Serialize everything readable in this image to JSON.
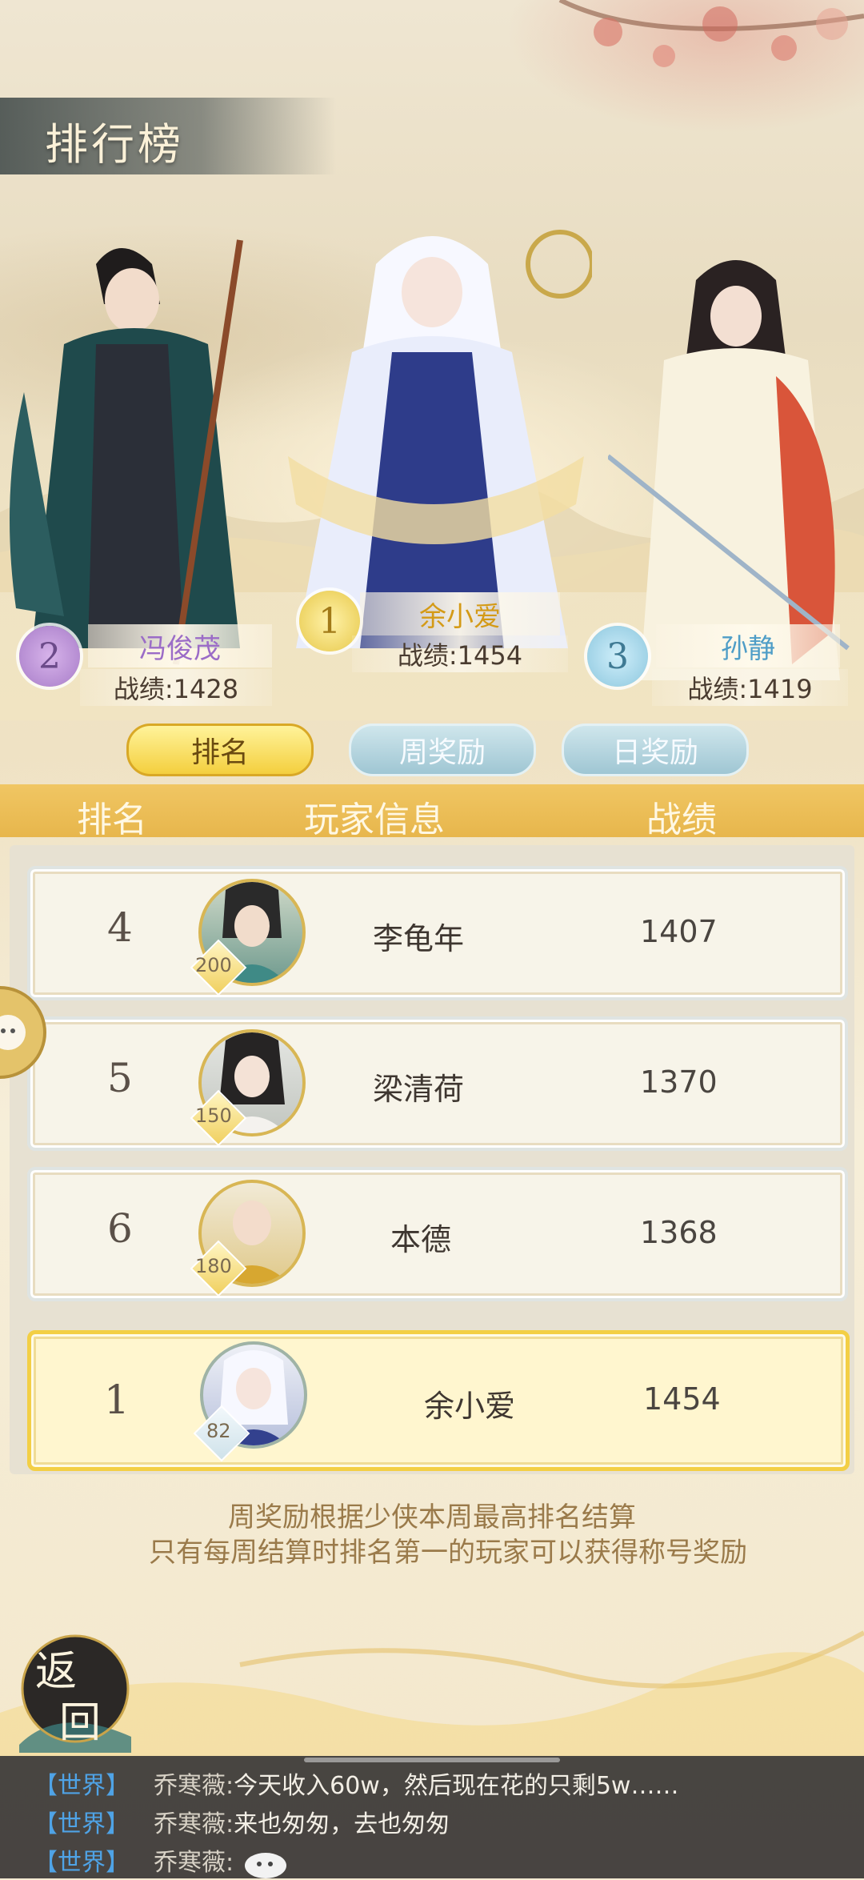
{
  "page": {
    "title": "排行榜"
  },
  "podium": [
    {
      "rank": "2",
      "name": "冯俊茂",
      "score_label": "战绩:1428"
    },
    {
      "rank": "1",
      "name": "余小爱",
      "score_label": "战绩:1454"
    },
    {
      "rank": "3",
      "name": "孙静",
      "score_label": "战绩:1419"
    }
  ],
  "tabs": [
    "排名",
    "周奖励",
    "日奖励"
  ],
  "active_tab": 0,
  "columns": [
    "排名",
    "玩家信息",
    "战绩"
  ],
  "rows": [
    {
      "rank": "4",
      "level": "200",
      "name": "李龟年",
      "score": "1407"
    },
    {
      "rank": "5",
      "level": "150",
      "name": "梁清荷",
      "score": "1370"
    },
    {
      "rank": "6",
      "level": "180",
      "name": "本德",
      "score": "1368"
    }
  ],
  "self_row": {
    "rank": "1",
    "level": "82",
    "name": "余小爱",
    "score": "1454"
  },
  "notes": [
    "周奖励根据少侠本周最高排名结算",
    "只有每周结算时排名第一的玩家可以获得称号奖励"
  ],
  "back_button": {
    "label_top": "返",
    "label_bottom": "回"
  },
  "chat": [
    {
      "channel": "【世界】",
      "user": "乔寒薇:",
      "message": "今天收入60w，然后现在花的只剩5w……"
    },
    {
      "channel": "【世界】",
      "user": "乔寒薇:",
      "message": "来也匆匆，去也匆匆"
    },
    {
      "channel": "【世界】",
      "user": "乔寒薇:",
      "message": ""
    }
  ],
  "colors": {
    "gold": "#f0c663",
    "tab_active": "#f4cf3e",
    "tab_inactive": "#9fc6d3",
    "chat_channel": "#4fa3e6"
  }
}
